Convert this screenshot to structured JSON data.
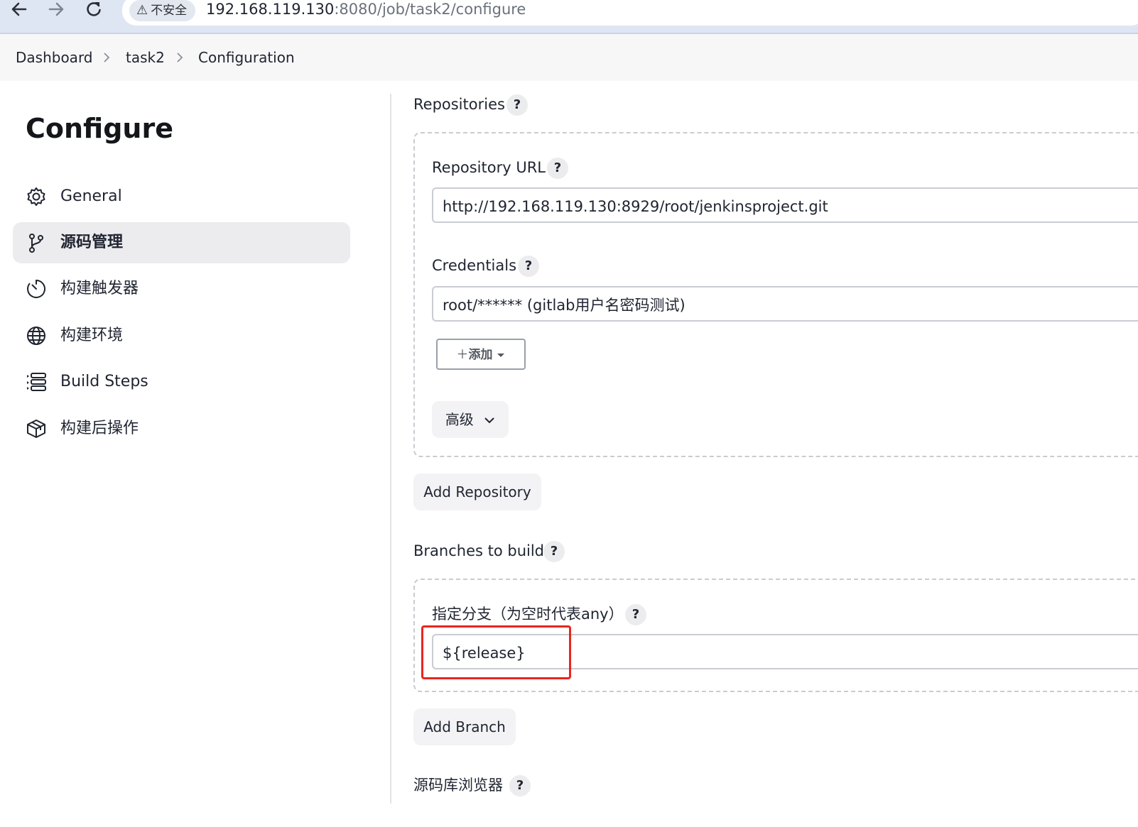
{
  "browser": {
    "back_icon": "arrow-left-icon",
    "forward_icon": "arrow-right-icon",
    "reload_icon": "reload-icon",
    "security_label": "不安全",
    "url_host": "192.168.119.130",
    "url_rest": ":8080/job/task2/configure"
  },
  "breadcrumb": {
    "items": [
      "Dashboard",
      "task2",
      "Configuration"
    ],
    "separator": ">"
  },
  "sidebar": {
    "title": "Configure",
    "items": [
      {
        "label": "General",
        "icon": "gear-icon",
        "active": false
      },
      {
        "label": "源码管理",
        "icon": "branch-icon",
        "active": true
      },
      {
        "label": "构建触发器",
        "icon": "timer-icon",
        "active": false
      },
      {
        "label": "构建环境",
        "icon": "globe-icon",
        "active": false
      },
      {
        "label": "Build Steps",
        "icon": "list-icon",
        "active": false
      },
      {
        "label": "构建后操作",
        "icon": "package-icon",
        "active": false
      }
    ]
  },
  "main": {
    "repositories_label": "Repositories",
    "repo_url_label": "Repository URL",
    "repo_url_value": "http://192.168.119.130:8929/root/jenkinsproject.git",
    "credentials_label": "Credentials",
    "credentials_value": "root/****** (gitlab用户名密码测试)",
    "add_button_label": "添加",
    "advanced_label": "高级",
    "add_repository_label": "Add Repository",
    "branches_label": "Branches to build",
    "branch_specifier_label": "指定分支（为空时代表any）",
    "branch_specifier_value": "${release}",
    "add_branch_label": "Add Branch",
    "repo_browser_label": "源码库浏览器",
    "help_glyph": "?"
  },
  "colors": {
    "highlight": "#e8261d",
    "active_bg": "#ececee"
  }
}
